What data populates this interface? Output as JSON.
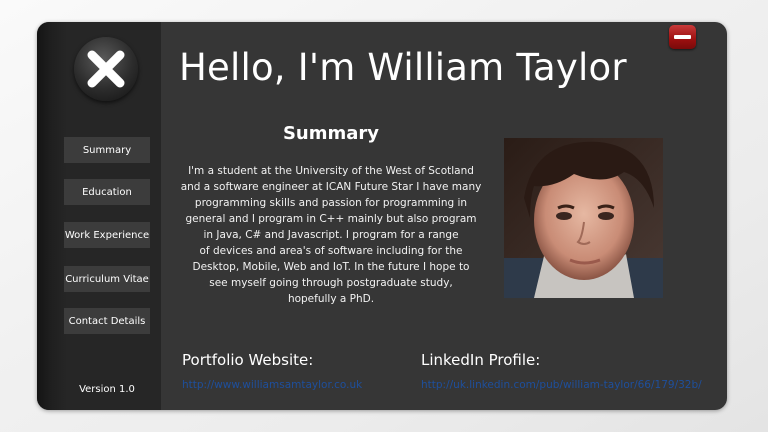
{
  "header": {
    "title": "Hello, I'm William Taylor"
  },
  "sidebar": {
    "logo_icon": "x-close-icon",
    "items": [
      {
        "label": "Summary"
      },
      {
        "label": "Education"
      },
      {
        "label": "Work Experience"
      },
      {
        "label": "Curriculum Vitae"
      },
      {
        "label": "Contact Details"
      }
    ],
    "version": "Version 1.0"
  },
  "window_controls": {
    "minimize_icon": "minus-icon",
    "accent": "#9c1010"
  },
  "summary": {
    "heading": "Summary",
    "lines": [
      "I'm a student at the University of the West of Scotland",
      "and a software engineer at ICAN Future Star I have many",
      "programming skills and passion for programming in",
      "general and I program in C++ mainly but also program",
      "in Java, C# and Javascript. I program for a range",
      "of devices and area's of software including for the",
      "Desktop, Mobile, Web and IoT. In the future I hope to",
      "see myself going through postgraduate study,",
      "hopefully a PhD."
    ]
  },
  "links": {
    "portfolio": {
      "label": "Portfolio Website:",
      "url": "http://www.williamsamtaylor.co.uk"
    },
    "linkedin": {
      "label": "LinkedIn Profile:",
      "url": "http://uk.linkedin.com/pub/william-taylor/66/179/32b/"
    }
  },
  "colors": {
    "window_bg": "#363636",
    "sidebar_bg": "#262626",
    "button_bg": "#3c3c3c",
    "link": "#1e4f9c"
  }
}
